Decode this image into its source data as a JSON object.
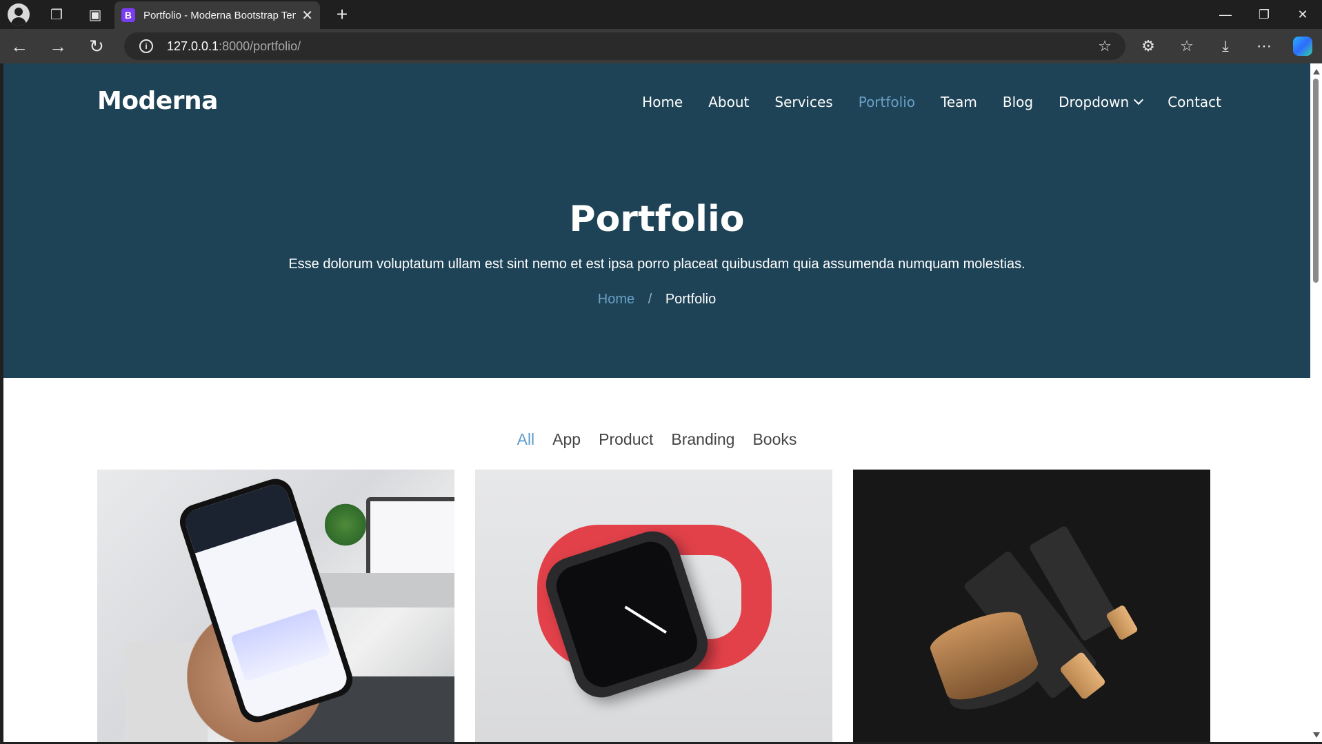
{
  "browser": {
    "tab_title": "Portfolio - Moderna Bootstrap Template",
    "tab_favicon_letter": "B",
    "url_host": "127.0.0.1",
    "url_path": ":8000/portfolio/"
  },
  "site": {
    "logo": "Moderna",
    "nav": [
      {
        "label": "Home"
      },
      {
        "label": "About"
      },
      {
        "label": "Services"
      },
      {
        "label": "Portfolio"
      },
      {
        "label": "Team"
      },
      {
        "label": "Blog"
      },
      {
        "label": "Dropdown"
      },
      {
        "label": "Contact"
      }
    ],
    "active_nav": "Portfolio"
  },
  "hero": {
    "title": "Portfolio",
    "subtitle": "Esse dolorum voluptatum ullam est sint nemo et est ipsa porro placeat quibusdam quia assumenda numquam molestias.",
    "breadcrumb": {
      "home": "Home",
      "separator": "/",
      "current": "Portfolio"
    }
  },
  "filters": [
    {
      "label": "All"
    },
    {
      "label": "App"
    },
    {
      "label": "Product"
    },
    {
      "label": "Branding"
    },
    {
      "label": "Books"
    }
  ],
  "active_filter": "All",
  "colors": {
    "hero_bg": "#1e4356",
    "accent": "#5c9ccb",
    "page_bg": "#ffffff"
  }
}
